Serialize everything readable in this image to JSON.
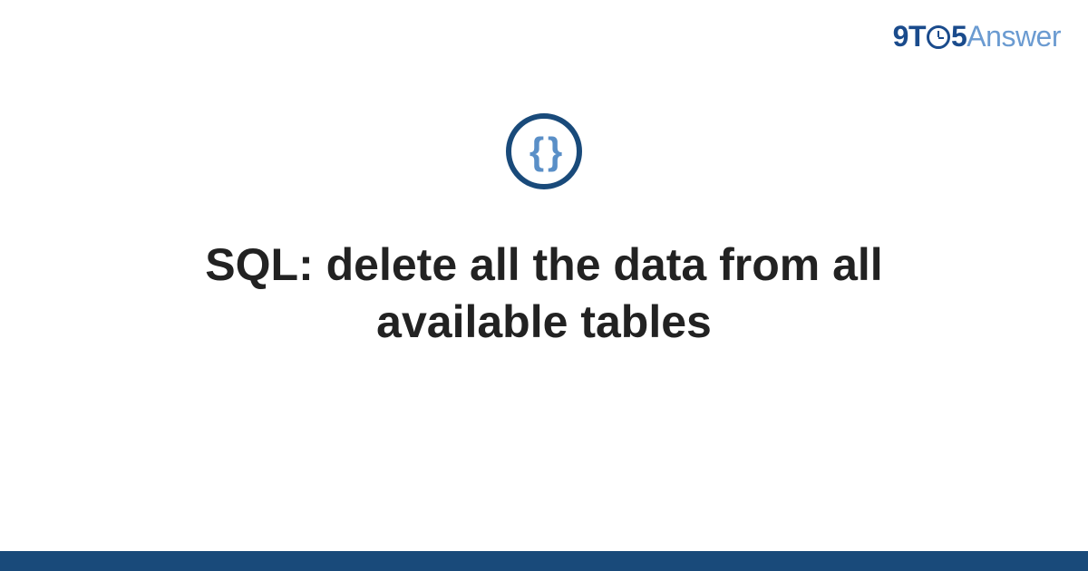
{
  "brand": {
    "part1": "9T",
    "part2": "5",
    "part3": "Answer"
  },
  "icon": {
    "symbol": "{ }"
  },
  "title": "SQL: delete all the data from all available tables",
  "colors": {
    "brand_dark": "#194a7a",
    "brand_light": "#6b9bd1",
    "text": "#222222"
  }
}
